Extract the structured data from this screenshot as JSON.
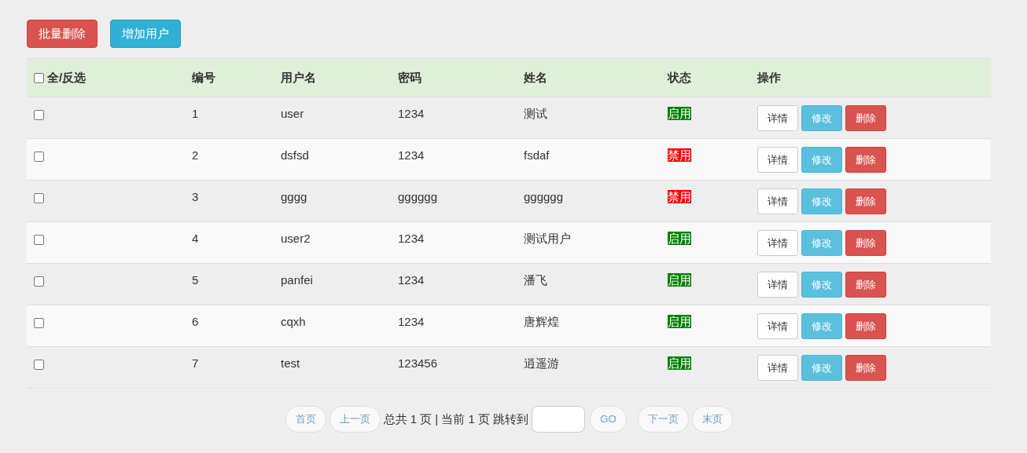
{
  "toolbar": [
    {
      "label": "批量删除",
      "kind": "danger"
    },
    {
      "label": "增加用户",
      "kind": "info"
    }
  ],
  "table": {
    "select_all": {
      "label": "全/反选",
      "checked": false
    },
    "columns": [
      "编号",
      "用户名",
      "密码",
      "姓名",
      "状态",
      "操作"
    ],
    "rows": [
      {
        "checked": false,
        "id": "1",
        "username": "user",
        "password": "1234",
        "name": "测试",
        "status": {
          "text": "启用",
          "color": "#008000"
        },
        "actions": [
          {
            "label": "详情",
            "kind": "default"
          },
          {
            "label": "修改",
            "kind": "info"
          },
          {
            "label": "删除",
            "kind": "danger"
          }
        ]
      },
      {
        "checked": false,
        "id": "2",
        "username": "dsfsd",
        "password": "1234",
        "name": "fsdaf",
        "status": {
          "text": "禁用",
          "color": "#ff0000"
        },
        "actions": [
          {
            "label": "详情",
            "kind": "default"
          },
          {
            "label": "修改",
            "kind": "info"
          },
          {
            "label": "删除",
            "kind": "danger"
          }
        ]
      },
      {
        "checked": false,
        "id": "3",
        "username": "gggg",
        "password": "gggggg",
        "name": "gggggg",
        "status": {
          "text": "禁用",
          "color": "#ff0000"
        },
        "actions": [
          {
            "label": "详情",
            "kind": "default"
          },
          {
            "label": "修改",
            "kind": "info"
          },
          {
            "label": "删除",
            "kind": "danger"
          }
        ]
      },
      {
        "checked": false,
        "id": "4",
        "username": "user2",
        "password": "1234",
        "name": "测试用户",
        "status": {
          "text": "启用",
          "color": "#008000"
        },
        "actions": [
          {
            "label": "详情",
            "kind": "default"
          },
          {
            "label": "修改",
            "kind": "info"
          },
          {
            "label": "删除",
            "kind": "danger"
          }
        ]
      },
      {
        "checked": false,
        "id": "5",
        "username": "panfei",
        "password": "1234",
        "name": "潘飞",
        "status": {
          "text": "启用",
          "color": "#008000"
        },
        "actions": [
          {
            "label": "详情",
            "kind": "default"
          },
          {
            "label": "修改",
            "kind": "info"
          },
          {
            "label": "删除",
            "kind": "danger"
          }
        ]
      },
      {
        "checked": false,
        "id": "6",
        "username": "cqxh",
        "password": "1234",
        "name": "唐辉煌",
        "status": {
          "text": "启用",
          "color": "#008000"
        },
        "actions": [
          {
            "label": "详情",
            "kind": "default"
          },
          {
            "label": "修改",
            "kind": "info"
          },
          {
            "label": "删除",
            "kind": "danger"
          }
        ]
      },
      {
        "checked": false,
        "id": "7",
        "username": "test",
        "password": "123456",
        "name": "逍遥游",
        "status": {
          "text": "启用",
          "color": "#008000"
        },
        "actions": [
          {
            "label": "详情",
            "kind": "default"
          },
          {
            "label": "修改",
            "kind": "info"
          },
          {
            "label": "删除",
            "kind": "danger"
          }
        ]
      }
    ]
  },
  "pagination": {
    "first": "首页",
    "prev": "上一页",
    "info": "总共 1 页 | 当前 1 页 跳转到",
    "go": "GO",
    "next": "下一页",
    "last": "末页"
  }
}
